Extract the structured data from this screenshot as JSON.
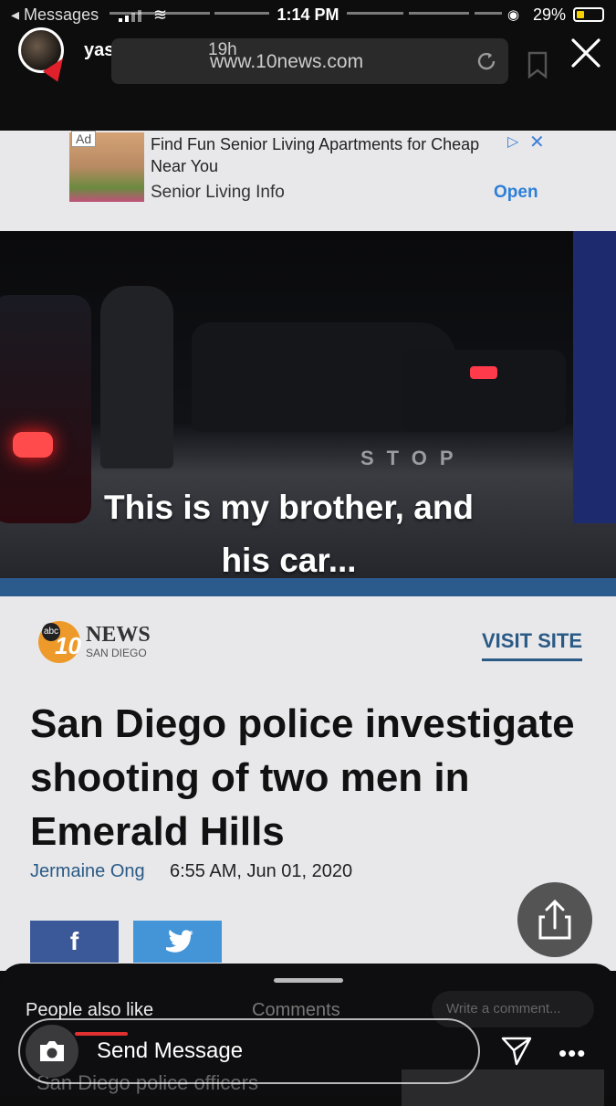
{
  "status_bar": {
    "back_label": "◂ Messages",
    "time": "1:14 PM",
    "battery": "29%"
  },
  "story": {
    "username": "yaskinnayy",
    "time_ago": "19h"
  },
  "browser": {
    "url": "www.10news.com"
  },
  "ad": {
    "badge": "Ad",
    "headline": "Find Fun Senior Living Apartments for Cheap Near You",
    "advertiser": "Senior Living Info",
    "open_label": "Open"
  },
  "article": {
    "caption_line1": "This is my brother, and",
    "caption_line2": "his car...",
    "photo_sign": "STOP",
    "logo_abc": "abc",
    "logo_number": "10",
    "logo_news": "NEWS",
    "logo_sub": "SAN DIEGO",
    "visit_site": "VISIT SITE",
    "headline": "San Diego police investigate shooting of two men in Emerald Hills",
    "author": "Jermaine Ong",
    "date": "6:55 AM, Jun 01, 2020",
    "fb_label": "f"
  },
  "sheet": {
    "tab_people": "People also like",
    "tab_comments": "Comments",
    "comment_placeholder": "Write a comment...",
    "related_title": "San Diego police officers"
  },
  "reply": {
    "send_message": "Send Message",
    "more": "•••"
  },
  "colors": {
    "accent_blue": "#2a5a86",
    "facebook": "#3b5998",
    "twitter": "#4495d8",
    "battery_low": "#f5d000"
  }
}
